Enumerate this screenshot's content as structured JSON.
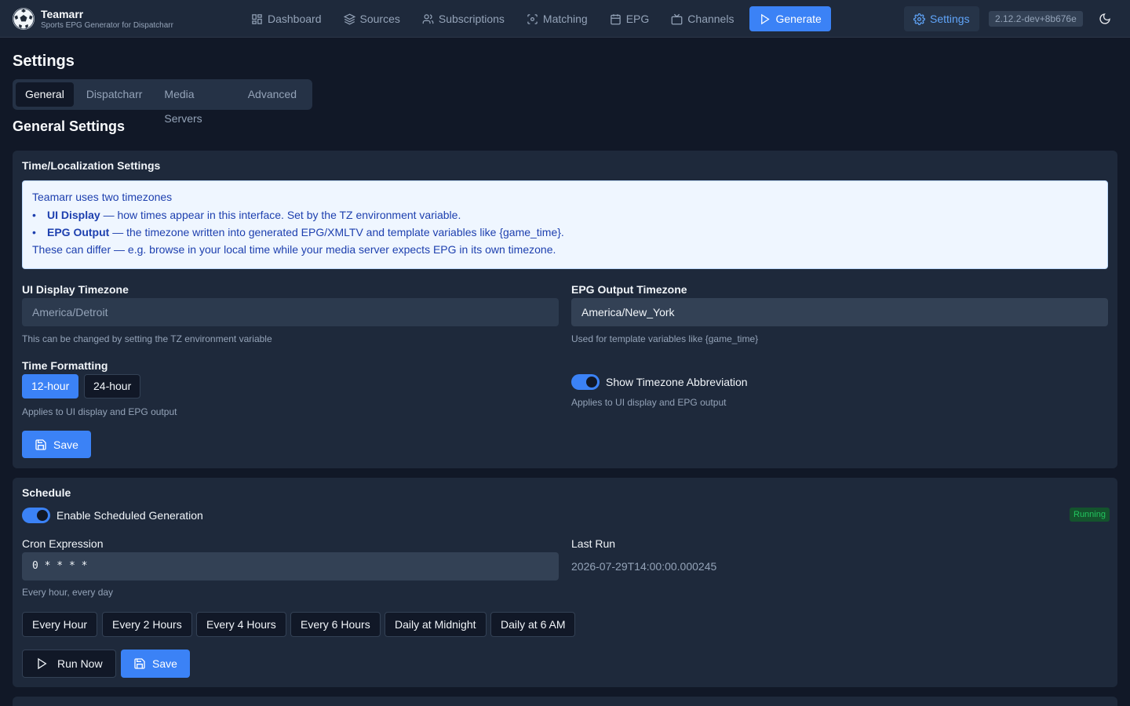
{
  "app": {
    "title": "Teamarr",
    "subtitle": "Sports EPG Generator for Dispatcharr",
    "version": "2.12.2-dev+8b676e"
  },
  "nav": {
    "items": [
      {
        "label": "Dashboard",
        "icon": "dashboard-icon"
      },
      {
        "label": "Sources",
        "icon": "layers-icon"
      },
      {
        "label": "Subscriptions",
        "icon": "users-icon"
      },
      {
        "label": "Matching",
        "icon": "scan-icon"
      },
      {
        "label": "EPG",
        "icon": "calendar-icon"
      },
      {
        "label": "Channels",
        "icon": "tv-icon"
      }
    ],
    "generate_label": "Generate",
    "settings_label": "Settings"
  },
  "page": {
    "title": "Settings",
    "tabs": [
      "General",
      "Dispatcharr",
      "Media Servers",
      "Advanced"
    ],
    "active_tab": "General",
    "section_title": "General Settings"
  },
  "time_card": {
    "title": "Time/Localization Settings",
    "info": {
      "intro": "Teamarr uses two timezones",
      "bullet1_bold": "UI Display",
      "bullet1_text": " — how times appear in this interface. Set by the TZ environment variable.",
      "bullet2_bold": "EPG Output",
      "bullet2_text": " — the timezone written into generated EPG/XMLTV and template variables like {game_time}.",
      "outro": "These can differ — e.g. browse in your local time while your media server expects EPG in its own timezone."
    },
    "ui_tz_label": "UI Display Timezone",
    "ui_tz_value": "America/Detroit",
    "ui_tz_help": "This can be changed by setting the TZ environment variable",
    "epg_tz_label": "EPG Output Timezone",
    "epg_tz_value": "America/New_York",
    "epg_tz_help": "Used for template variables like {game_time}",
    "time_format_label": "Time Formatting",
    "format_12": "12-hour",
    "format_24": "24-hour",
    "format_selected": "12-hour",
    "format_help": "Applies to UI display and EPG output",
    "show_tz_abbr_label": "Show Timezone Abbreviation",
    "show_tz_abbr_on": true,
    "show_tz_abbr_help": "Applies to UI display and EPG output",
    "save_label": "Save"
  },
  "schedule_card": {
    "title": "Schedule",
    "enable_label": "Enable Scheduled Generation",
    "enabled": true,
    "status_badge": "Running",
    "cron_label": "Cron Expression",
    "cron_value": "0 * * * *",
    "cron_help": "Every hour, every day",
    "last_run_label": "Last Run",
    "last_run_value": "2026-07-29T14:00:00.000245",
    "presets": [
      "Every Hour",
      "Every 2 Hours",
      "Every 4 Hours",
      "Every 6 Hours",
      "Daily at Midnight",
      "Daily at 6 AM"
    ],
    "run_now_label": "Run Now",
    "save_label": "Save"
  },
  "colors": {
    "background": "#111827",
    "surface": "#1e293b",
    "accent": "#3b82f6",
    "success": "#22c55e",
    "info_bg": "#eff6ff",
    "info_text": "#1e40af"
  }
}
